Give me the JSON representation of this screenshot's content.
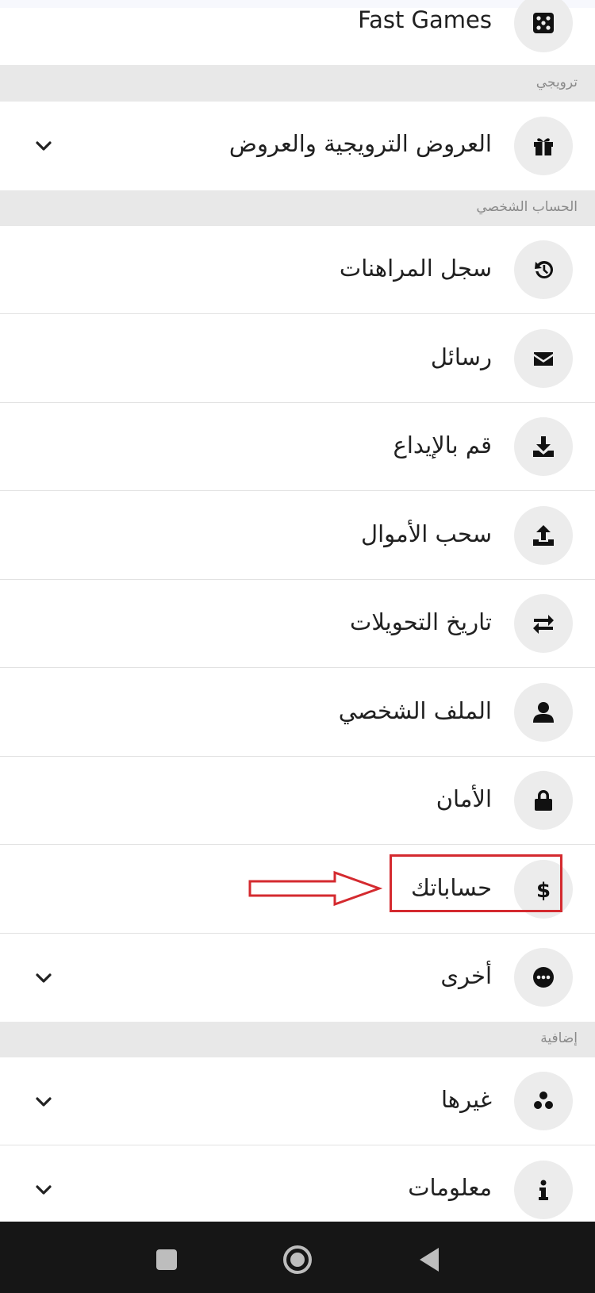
{
  "menu": {
    "top_item": {
      "label": "Fast Games",
      "icon": "dice-icon"
    },
    "sections": [
      {
        "title": "ترويجي"
      },
      {
        "title": "الحساب الشخصي"
      },
      {
        "title": "إضافية"
      }
    ],
    "promo_items": [
      {
        "label": "العروض الترويجية والعروض",
        "icon": "gift-icon",
        "expandable": true
      }
    ],
    "account_items": [
      {
        "label": "سجل المراهنات",
        "icon": "history-icon"
      },
      {
        "label": "رسائل",
        "icon": "envelope-icon"
      },
      {
        "label": "قم بالإيداع",
        "icon": "download-icon"
      },
      {
        "label": "سحب الأموال",
        "icon": "upload-icon"
      },
      {
        "label": "تاريخ التحويلات",
        "icon": "transfer-icon"
      },
      {
        "label": "الملف الشخصي",
        "icon": "user-icon"
      },
      {
        "label": "الأمان",
        "icon": "lock-icon"
      },
      {
        "label": "حساباتك",
        "icon": "dollar-icon"
      },
      {
        "label": "أخرى",
        "icon": "more-dots-icon",
        "expandable": true
      }
    ],
    "extra_items": [
      {
        "label": "غيرها",
        "icon": "three-dots-cluster-icon",
        "expandable": true
      },
      {
        "label": "معلومات",
        "icon": "info-icon",
        "expandable": true
      }
    ]
  },
  "annotation": {
    "highlight_color": "#d42a2f",
    "target_item": "حساباتك"
  },
  "navbar": {
    "buttons": [
      "recent-apps-button",
      "home-button",
      "back-button"
    ]
  }
}
